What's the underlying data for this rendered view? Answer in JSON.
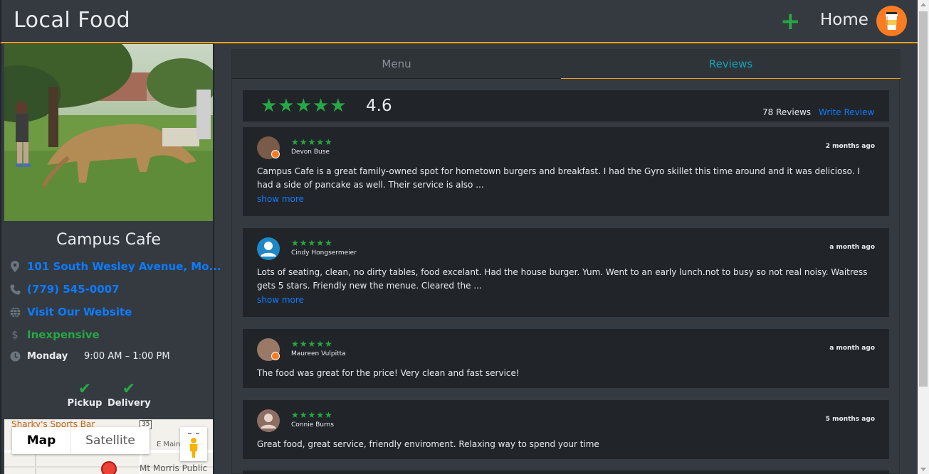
{
  "app": {
    "brand": "Local Food",
    "nav_add_glyph": "+",
    "nav_home": "Home",
    "accent": "#f0a020",
    "green": "#28a745",
    "link": "#0d7bff"
  },
  "place": {
    "name": "Campus Cafe",
    "address": "101 South Wesley Avenue, Mo...",
    "phone": "(779) 545-0007",
    "website": "Visit Our Website",
    "price": "Inexpensive",
    "day": "Monday",
    "hours": "9:00 AM – 1:00 PM",
    "services": [
      {
        "label": "Pickup",
        "glyph": "✔"
      },
      {
        "label": "Delivery",
        "glyph": "✔"
      }
    ],
    "icons": {
      "address": "map-marker-icon",
      "phone": "phone-icon",
      "website": "globe-icon",
      "price": "dollar-icon",
      "hours": "clock-icon"
    }
  },
  "map": {
    "map_label": "Map",
    "satellite_label": "Satellite",
    "labels": {
      "poi": "Sharky's Sports Bar",
      "road": "E Main",
      "route": "35",
      "library": "Mt Morris Public"
    }
  },
  "tabs": {
    "menu": "Menu",
    "reviews": "Reviews"
  },
  "summary": {
    "stars": "★★★★★",
    "rating": "4.6",
    "count": "78 Reviews",
    "write": "Write Review"
  },
  "reviews": [
    {
      "name": "Devon Buse",
      "stars": "★★★★★",
      "time": "2 months ago",
      "text": "Campus Cafe is a great family-owned spot for hometown burgers and breakfast. I had the Gyro skillet this time around and it was delicioso. I had a side of pancake as well. Their service is also ...",
      "more": "show more",
      "avatar_color": "#7a5a48"
    },
    {
      "name": "Cindy Hongsermeier",
      "stars": "★★★★★",
      "time": "a month ago",
      "text": "Lots of seating, clean, no dirty tables, food excelant. Had the house burger. Yum. Went to an early lunch.not to busy so not real noisy. Waitress gets 5 stars. Friendly new the menue. Cleared the ...",
      "more": "show more",
      "avatar_color": "#1e88c7"
    },
    {
      "name": "Maureen Vulpitta",
      "stars": "★★★★★",
      "time": "a month ago",
      "text": "The food was great for the price! Very clean and fast service!",
      "avatar_color": "#9a7a66"
    },
    {
      "name": "Connie Burns",
      "stars": "★★★★★",
      "time": "5 months ago",
      "text": "Great food, great service, friendly enviroment. Relaxing way to spend your time",
      "avatar_color": "#8d6e63"
    }
  ]
}
